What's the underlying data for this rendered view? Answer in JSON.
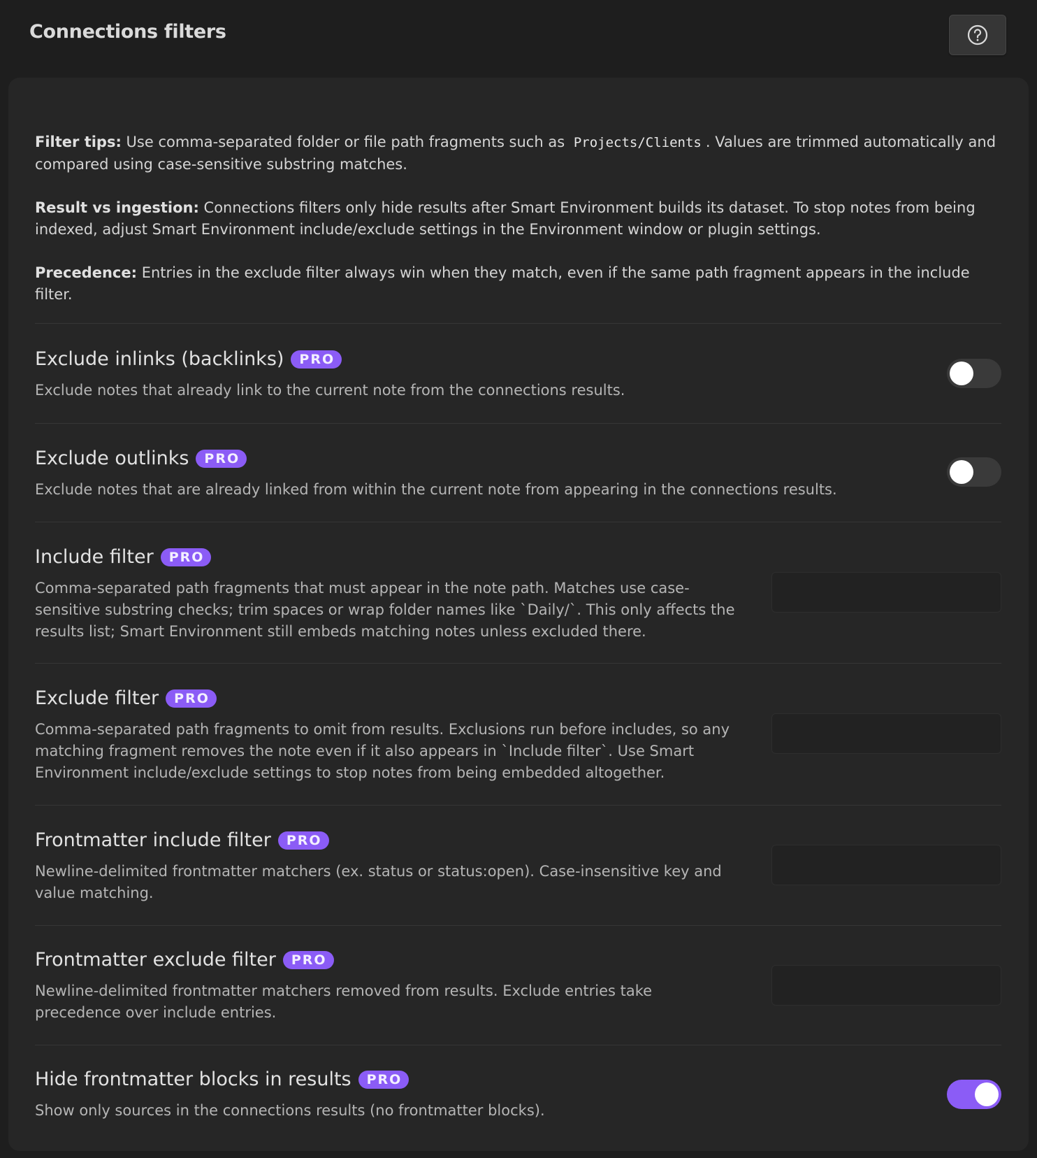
{
  "header": {
    "title": "Connections filters",
    "help_icon": "question-circle-icon"
  },
  "tips": {
    "filter_tips": {
      "label": "Filter tips:",
      "text_before": "Use comma-separated folder or file path fragments such as",
      "code": "Projects/Clients",
      "text_after": ". Values are trimmed automatically and compared using case-sensitive substring matches."
    },
    "result_vs_ingestion": {
      "label": "Result vs ingestion:",
      "text": "Connections filters only hide results after Smart Environment builds its dataset. To stop notes from being indexed, adjust Smart Environment include/exclude settings in the Environment window or plugin settings."
    },
    "precedence": {
      "label": "Precedence:",
      "text": "Entries in the exclude filter always win when they match, even if the same path fragment appears in the include filter."
    }
  },
  "badge_label": "PRO",
  "settings": {
    "exclude_inlinks": {
      "name": "Exclude inlinks (backlinks)",
      "desc": "Exclude notes that already link to the current note from the connections results.",
      "enabled": false
    },
    "exclude_outlinks": {
      "name": "Exclude outlinks",
      "desc": "Exclude notes that are already linked from within the current note from appearing in the connections results.",
      "enabled": false
    },
    "include_filter": {
      "name": "Include filter",
      "desc": "Comma-separated path fragments that must appear in the note path. Matches use case-sensitive substring checks; trim spaces or wrap folder names like `Daily/`. This only affects the results list; Smart Environment still embeds matching notes unless excluded there.",
      "value": ""
    },
    "exclude_filter": {
      "name": "Exclude filter",
      "desc": "Comma-separated path fragments to omit from results. Exclusions run before includes, so any matching fragment removes the note even if it also appears in `Include filter`. Use Smart Environment include/exclude settings to stop notes from being embedded altogether.",
      "value": ""
    },
    "frontmatter_include": {
      "name": "Frontmatter include filter",
      "desc": "Newline-delimited frontmatter matchers (ex. status or status:open). Case-insensitive key and value matching.",
      "value": ""
    },
    "frontmatter_exclude": {
      "name": "Frontmatter exclude filter",
      "desc": "Newline-delimited frontmatter matchers removed from results. Exclude entries take precedence over include entries.",
      "value": ""
    },
    "hide_frontmatter": {
      "name": "Hide frontmatter blocks in results",
      "desc": "Show only sources in the connections results (no frontmatter blocks).",
      "enabled": true
    }
  },
  "colors": {
    "accent": "#8b5cf6",
    "background": "#1e1e1e",
    "card": "#262626"
  }
}
